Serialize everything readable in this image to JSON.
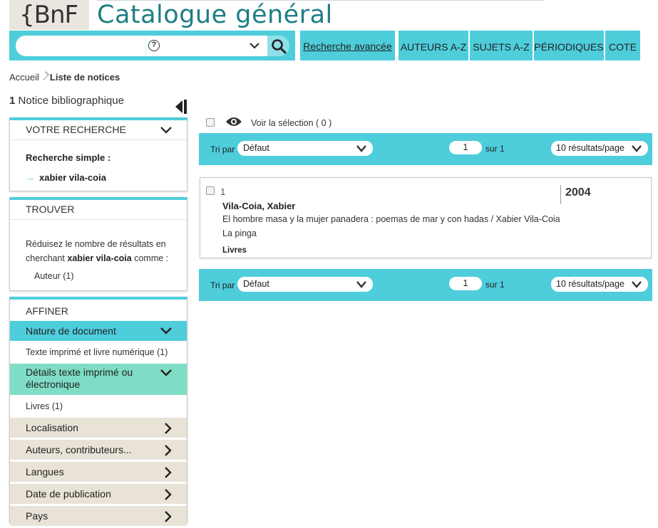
{
  "header": {
    "logo_text": "{BnF",
    "title": "Catalogue général"
  },
  "search": {
    "placeholder": "",
    "help_symbol": "?",
    "button": "search-icon"
  },
  "nav": {
    "advanced": "Recherche avancée",
    "items": [
      "AUTEURS A-Z",
      "SUJETS A-Z",
      "PÉRIODIQUES",
      "COTE"
    ]
  },
  "breadcrumb": {
    "home": "Accueil",
    "current": "Liste de notices"
  },
  "result_count": {
    "number": "1",
    "label": "Notice bibliographique"
  },
  "sidebar": {
    "votre_recherche": {
      "title": "VOTRE RECHERCHE",
      "label": "Recherche simple :",
      "arrow": "→",
      "query": "xabier vila-coia"
    },
    "trouver": {
      "title": "TROUVER",
      "text_before": "Réduisez le nombre de résultats en cherchant",
      "term": "xabier vila-coia",
      "text_after": "comme :",
      "option": "Auteur (1)"
    },
    "affiner": {
      "title": "AFFINER",
      "nature": "Nature de document",
      "nature_value": "Texte imprimé et livre numérique (1)",
      "details": "Détails texte imprimé ou électronique",
      "details_value": "Livres (1)",
      "collapsed": [
        "Localisation",
        "Auteurs, contributeurs...",
        "Langues",
        "Date de publication",
        "Pays"
      ]
    }
  },
  "selection": {
    "label": "Voir la sélection ( 0 )"
  },
  "sortbar": {
    "tri_label": "Tri par :",
    "tri_value": "Défaut",
    "page": "1",
    "sur": "sur 1",
    "per_page": "10 résultats/page"
  },
  "notice": {
    "index": "1",
    "author": "Vila-Coia, Xabier",
    "title": "El hombre masa y la mujer panadera : poemas de mar y con hadas / Xabier Vila-Coia",
    "publisher": "La pinga",
    "type": "Livres",
    "year": "2004"
  },
  "colors": {
    "teal": "#4ecddb",
    "title_teal": "#1e7d84",
    "green": "#7fdcc5",
    "beige": "#e9e3d7"
  }
}
